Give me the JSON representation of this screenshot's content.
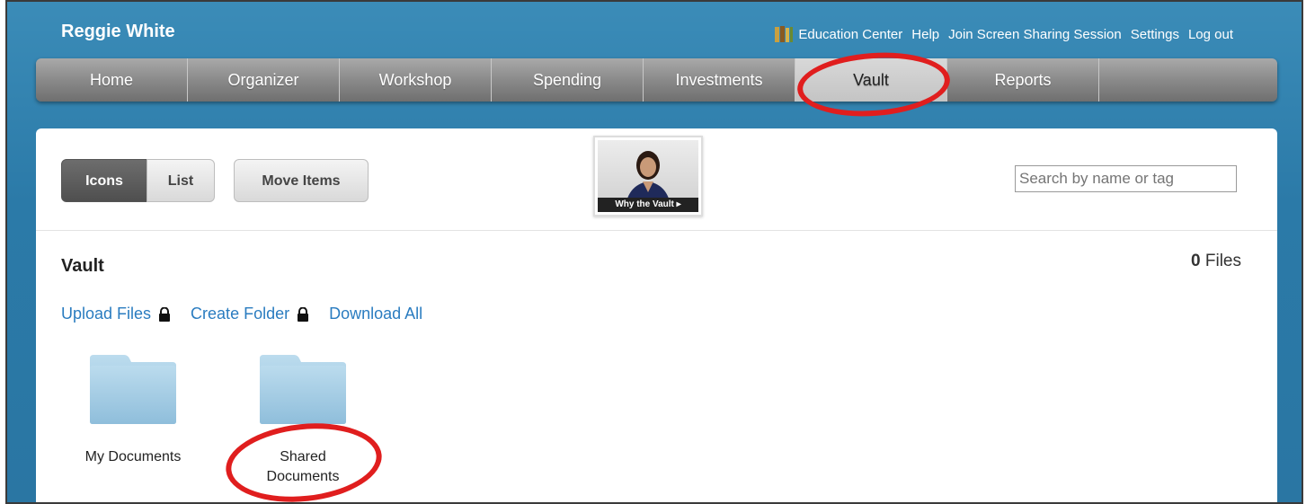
{
  "header": {
    "user_name": "Reggie White",
    "links": {
      "education_center": "Education Center",
      "help": "Help",
      "screen_sharing": "Join Screen Sharing Session",
      "settings": "Settings",
      "logout": "Log out"
    }
  },
  "nav": {
    "items": [
      "Home",
      "Organizer",
      "Workshop",
      "Spending",
      "Investments",
      "Vault",
      "Reports"
    ],
    "active": "Vault"
  },
  "toolbar": {
    "icons_label": "Icons",
    "list_label": "List",
    "move_label": "Move Items",
    "video_label": "Why the Vault ▸",
    "search_placeholder": "Search by name or tag"
  },
  "vault": {
    "title": "Vault",
    "file_count": "0",
    "file_unit": "Files",
    "actions": {
      "upload": "Upload Files",
      "create_folder": "Create Folder",
      "download_all": "Download All"
    },
    "folders": {
      "my_documents": "My Documents",
      "shared_line1": "Shared",
      "shared_line2": "Documents"
    }
  },
  "colors": {
    "accent_blue": "#2b7aa8",
    "link_blue": "#2a7cc0",
    "highlight_red": "#e01e1e",
    "folder_blue": "#a8cde3"
  }
}
